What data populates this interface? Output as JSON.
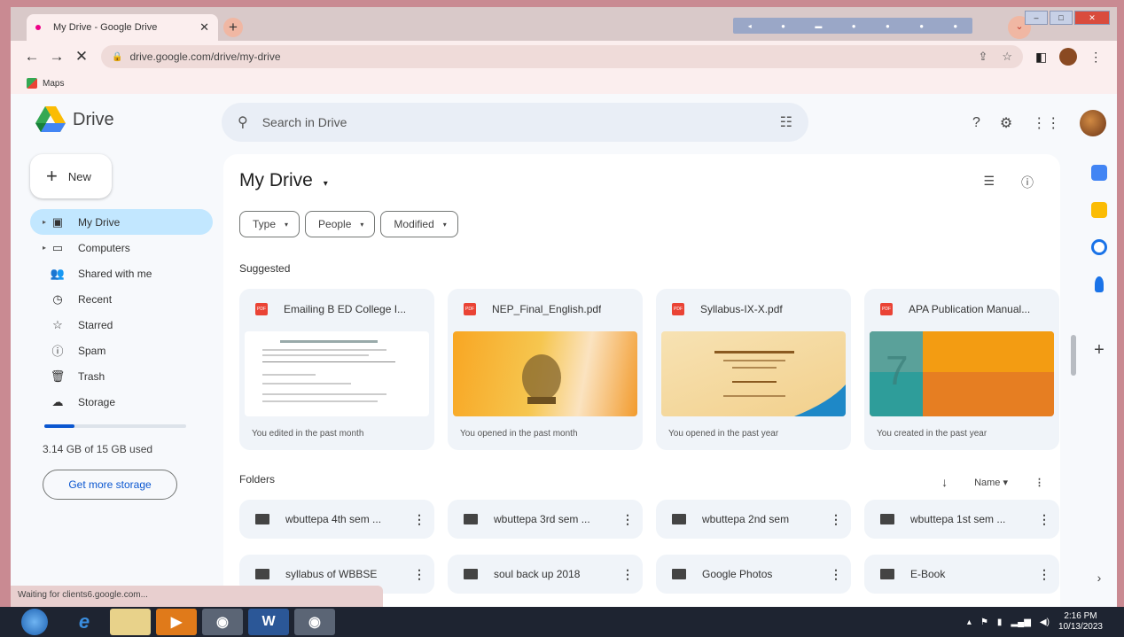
{
  "browser": {
    "tab_title": "My Drive - Google Drive",
    "url": "drive.google.com/drive/my-drive",
    "bookmark": "Maps",
    "status_text": "Waiting for clients6.google.com..."
  },
  "drive": {
    "logo_text": "Drive",
    "search_placeholder": "Search in Drive",
    "new_label": "New",
    "nav": [
      {
        "label": "My Drive",
        "icon": "my-drive-icon"
      },
      {
        "label": "Computers",
        "icon": "computers-icon"
      },
      {
        "label": "Shared with me",
        "icon": "shared-icon"
      },
      {
        "label": "Recent",
        "icon": "clock-icon"
      },
      {
        "label": "Starred",
        "icon": "star-icon"
      },
      {
        "label": "Spam",
        "icon": "spam-icon"
      },
      {
        "label": "Trash",
        "icon": "trash-icon"
      },
      {
        "label": "Storage",
        "icon": "cloud-icon"
      }
    ],
    "storage_used_fraction": 0.21,
    "storage_text": "3.14 GB of 15 GB used",
    "get_more_storage": "Get more storage",
    "page_title": "My Drive",
    "filters": [
      "Type",
      "People",
      "Modified"
    ],
    "suggested_label": "Suggested",
    "suggested": [
      {
        "name": "Emailing B ED College I...",
        "note": "You edited in the past month"
      },
      {
        "name": "NEP_Final_English.pdf",
        "note": "You opened in the past month"
      },
      {
        "name": "Syllabus-IX-X.pdf",
        "note": "You opened in the past year"
      },
      {
        "name": "APA Publication Manual...",
        "note": "You created in the past year"
      }
    ],
    "folders_label": "Folders",
    "sort_label": "Name",
    "folders": [
      "wbuttepa 4th sem ...",
      "wbuttepa 3rd sem ...",
      "wbuttepa 2nd sem",
      "wbuttepa 1st sem ...",
      "syllabus of WBBSE",
      "soul back up 2018",
      "Google Photos",
      "E-Book"
    ]
  },
  "taskbar": {
    "time": "2:16 PM",
    "date": "10/13/2023"
  },
  "colors": {
    "accent": "#0b57d0",
    "active_nav": "#c2e7ff",
    "pdf_red": "#ea4335"
  }
}
